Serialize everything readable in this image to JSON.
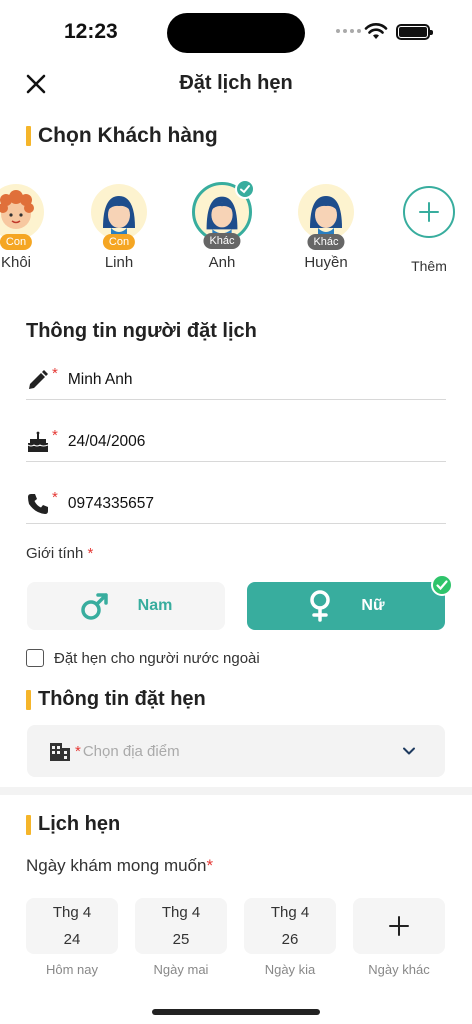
{
  "status": {
    "time": "12:23"
  },
  "header": {
    "title": "Đặt lịch hẹn"
  },
  "sections": {
    "customer": "Chọn Khách hàng",
    "booker_info": "Thông tin người đặt lịch",
    "appointment_info": "Thông tin đặt hẹn",
    "schedule": "Lịch hẹn"
  },
  "customers": [
    {
      "name": "Khôi",
      "tag": "Con",
      "avatar": "boy-avatar",
      "selected": false
    },
    {
      "name": "Linh",
      "tag": "Con",
      "avatar": "girl-avatar",
      "selected": false
    },
    {
      "name": "Anh",
      "tag": "Khác",
      "avatar": "woman-avatar",
      "selected": true
    },
    {
      "name": "Huyền",
      "tag": "Khác",
      "avatar": "woman-avatar",
      "selected": false
    }
  ],
  "add_customer": {
    "label": "Thêm",
    "icon": "plus-icon"
  },
  "form": {
    "name": "Minh Anh",
    "birthdate": "24/04/2006",
    "phone": "0974335657",
    "required_mark": "*"
  },
  "gender": {
    "label": "Giới tính",
    "required_mark": "*",
    "male": "Nam",
    "female": "Nữ",
    "selected": "female"
  },
  "foreign_checkbox": {
    "label": "Đặt hẹn cho người nước ngoài",
    "checked": false
  },
  "location": {
    "placeholder": "Chọn địa điểm",
    "required_mark": "*"
  },
  "schedule": {
    "date_label": "Ngày khám mong muốn",
    "required_mark": "*",
    "dates": [
      {
        "month": "Thg 4",
        "day": "24",
        "caption": "Hôm nay"
      },
      {
        "month": "Thg 4",
        "day": "25",
        "caption": "Ngày mai"
      },
      {
        "month": "Thg 4",
        "day": "26",
        "caption": "Ngày kia"
      }
    ],
    "other_caption": "Ngày khác"
  },
  "colors": {
    "accent": "#38ad9e",
    "section_bar": "#f5b52a",
    "required": "#e53935",
    "tag_con": "#f5a623",
    "tag_khac": "#666666"
  }
}
